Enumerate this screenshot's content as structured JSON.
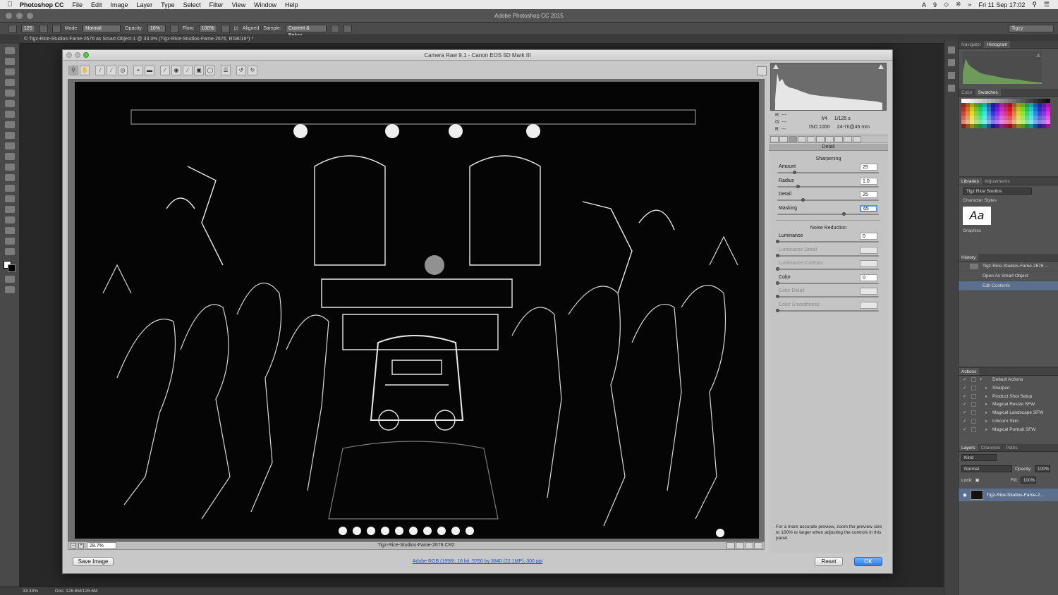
{
  "menubar": {
    "app": "Photoshop CC",
    "items": [
      "File",
      "Edit",
      "Image",
      "Layer",
      "Type",
      "Select",
      "Filter",
      "View",
      "Window",
      "Help"
    ],
    "status": {
      "adobe_count": "9",
      "clock": "Fri 11 Sep  17:02"
    }
  },
  "window_title": "Adobe Photoshop CC 2015",
  "options_bar": {
    "brush_size": "125",
    "mode_label": "Mode:",
    "mode_value": "Normal",
    "opacity_label": "Opacity:",
    "opacity_value": "10%",
    "flow_label": "Flow:",
    "flow_value": "100%",
    "aligned_label": "Aligned",
    "sample_label": "Sample:",
    "sample_value": "Current & Below",
    "workspace": "Tigzy"
  },
  "doc_tab": "© Tigz-Rice-Studios-Fame-2676 as Smart Object-1 @ 33.3% (Tigz-Rice-Studios-Fame-2676, RGB/16*) *",
  "dialog": {
    "title": "Camera Raw 9.1  -  Canon EOS 5D Mark III",
    "zoom": "28.7%",
    "filename": "Tigz-Rice-Studios-Fame-2676.CR2",
    "save_label": "Save Image",
    "workflow_link": "Adobe RGB (1998); 16 bit; 5760 by 3840 (22.1MP); 300 ppi",
    "reset_label": "Reset",
    "ok_label": "OK",
    "readout": {
      "r": "R:",
      "g": "G:",
      "b": "B:",
      "rv": "---",
      "gv": "---",
      "bv": "---"
    },
    "exif": {
      "aperture": "f/4",
      "shutter": "1/125 s",
      "iso": "ISO 1000",
      "lens": "24-70@45 mm"
    },
    "panel_title": "Detail",
    "sharpening": {
      "title": "Sharpening",
      "sliders": [
        {
          "label": "Amount",
          "value": "25",
          "pos": 0.167
        },
        {
          "label": "Radius",
          "value": "1.0",
          "pos": 0.2
        },
        {
          "label": "Detail",
          "value": "25",
          "pos": 0.25
        },
        {
          "label": "Masking",
          "value": "65",
          "pos": 0.65
        }
      ]
    },
    "noise": {
      "title": "Noise Reduction",
      "sliders": [
        {
          "label": "Luminance",
          "value": "0",
          "pos": 0,
          "dim": false
        },
        {
          "label": "Luminance Detail",
          "value": "",
          "pos": 0,
          "dim": true
        },
        {
          "label": "Luminance Contrast",
          "value": "",
          "pos": 0,
          "dim": true
        },
        {
          "label": "Color",
          "value": "0",
          "pos": 0,
          "dim": false
        },
        {
          "label": "Color Detail",
          "value": "",
          "pos": 0,
          "dim": true
        },
        {
          "label": "Color Smoothness",
          "value": "",
          "pos": 0,
          "dim": true
        }
      ]
    },
    "hint": "For a more accurate preview, zoom the preview size to 100% or larger when adjusting the controls in this panel."
  },
  "panels": {
    "nav_tabs": [
      "Navigator",
      "Histogram"
    ],
    "color_tabs": [
      "Color",
      "Swatches"
    ],
    "lib_tabs": [
      "Libraries",
      "Adjustments"
    ],
    "library": "Tigz Rice Studios",
    "char_styles": "Character Styles",
    "aa_text": "Aa",
    "graphics": "Graphics",
    "history_title": "History",
    "history": [
      {
        "label": "Tigz-Rice-Studios-Fame-2676 ...",
        "sel": false
      },
      {
        "label": "Open As Smart Object",
        "sel": false
      },
      {
        "label": "Edit Contents",
        "sel": true
      }
    ],
    "actions_title": "Actions",
    "actions": [
      {
        "label": "Default Actions",
        "folder": true
      },
      {
        "label": "Sharpen"
      },
      {
        "label": "Product Shot Setup"
      },
      {
        "label": "Magical Resize SFW"
      },
      {
        "label": "Magical Landscape SFW"
      },
      {
        "label": "Unicorn Skin"
      },
      {
        "label": "Magical Portrait SFW"
      }
    ],
    "layer_tabs": [
      "Layers",
      "Channels",
      "Paths"
    ],
    "kind": "Kind",
    "blend": "Normal",
    "opacity_label": "Opacity:",
    "opacity_value": "100%",
    "lock_label": "Lock:",
    "fill_label": "Fill:",
    "fill_value": "100%",
    "layer_name": "Tigz-Rice-Studios-Fame-2..."
  },
  "status": {
    "zoom": "33.33%",
    "doc": "Doc: 126.6M/126.6M"
  }
}
